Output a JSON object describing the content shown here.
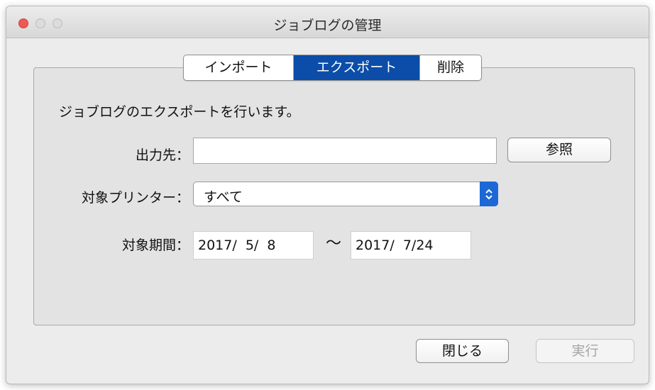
{
  "window": {
    "title": "ジョブログの管理"
  },
  "tabs": [
    {
      "label": "インポート",
      "selected": false
    },
    {
      "label": "エクスポート",
      "selected": true
    },
    {
      "label": "削除",
      "selected": false
    }
  ],
  "panel": {
    "description": "ジョブログのエクスポートを行います。",
    "output": {
      "label": "出力先：",
      "value": "",
      "browse_label": "参照"
    },
    "printer": {
      "label": "対象プリンター：",
      "selected": "すべて"
    },
    "period": {
      "label": "対象期間：",
      "start": "2017/  5/  8",
      "separator": "〜",
      "end": "2017/  7/24"
    }
  },
  "footer": {
    "close_label": "閉じる",
    "run_label": "実行"
  },
  "colors": {
    "selected_tab": "#0b4da8",
    "select_arrow": "#1c68d6",
    "close_light": "#ee5a52"
  }
}
